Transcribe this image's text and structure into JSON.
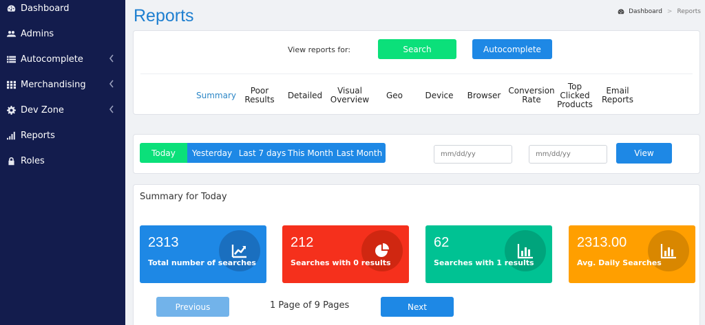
{
  "sidebar": {
    "items": [
      {
        "label": "Dashboard",
        "icon": "dashboard-icon"
      },
      {
        "label": "Admins",
        "icon": "users-icon"
      },
      {
        "label": "Autocomplete",
        "icon": "list-icon"
      },
      {
        "label": "Merchandising",
        "icon": "grid-icon"
      },
      {
        "label": "Dev Zone",
        "icon": "gear-icon"
      },
      {
        "label": "Reports",
        "icon": "signal-bars-icon"
      },
      {
        "label": "Roles",
        "icon": "lock-icon"
      }
    ]
  },
  "header": {
    "title": "Reports",
    "breadcrumb": {
      "home": "Dashboard",
      "separator": ">",
      "current": "Reports"
    }
  },
  "report_for": {
    "label": "View reports for:",
    "search_button": "Search",
    "autocomplete_button": "Autocomplete"
  },
  "tabs": [
    {
      "label": "Summary",
      "active": true
    },
    {
      "label": "Poor\nResults"
    },
    {
      "label": "Detailed"
    },
    {
      "label": "Visual\nOverview"
    },
    {
      "label": "Geo"
    },
    {
      "label": "Device"
    },
    {
      "label": "Browser"
    },
    {
      "label": "Conversion\nRate"
    },
    {
      "label": "Top\nClicked\nProducts"
    },
    {
      "label": "Email\nReports"
    }
  ],
  "ranges": {
    "options": [
      "Today",
      "Yesterday",
      "Last 7 days",
      "This Month",
      "Last Month"
    ],
    "selected": "Today",
    "date_from_placeholder": "mm/dd/yy",
    "date_to_placeholder": "mm/dd/yy",
    "view_button": "View"
  },
  "summary": {
    "title": "Summary for Today",
    "stats": [
      {
        "value": "2313",
        "label": "Total number of searches",
        "color": "#1e88e5",
        "icon": "trend-line-icon"
      },
      {
        "value": "212",
        "label": "Searches with 0 results",
        "color": "#f5301c",
        "icon": "pie-chart-icon"
      },
      {
        "value": "62",
        "label": "Searches with 1 results",
        "color": "#00c293",
        "icon": "bar-chart-icon"
      },
      {
        "value": "2313.00",
        "label": "Avg. Daily Searches",
        "color": "#ff9f00",
        "icon": "bar-chart-icon"
      }
    ]
  },
  "pagination": {
    "previous": "Previous",
    "info": "1 Page of 9 Pages",
    "next": "Next"
  },
  "colors": {
    "sidebar_bg": "#131c4d",
    "accent_blue": "#1e88e5",
    "accent_green": "#0be07a",
    "title_blue": "#1e7fd0"
  }
}
